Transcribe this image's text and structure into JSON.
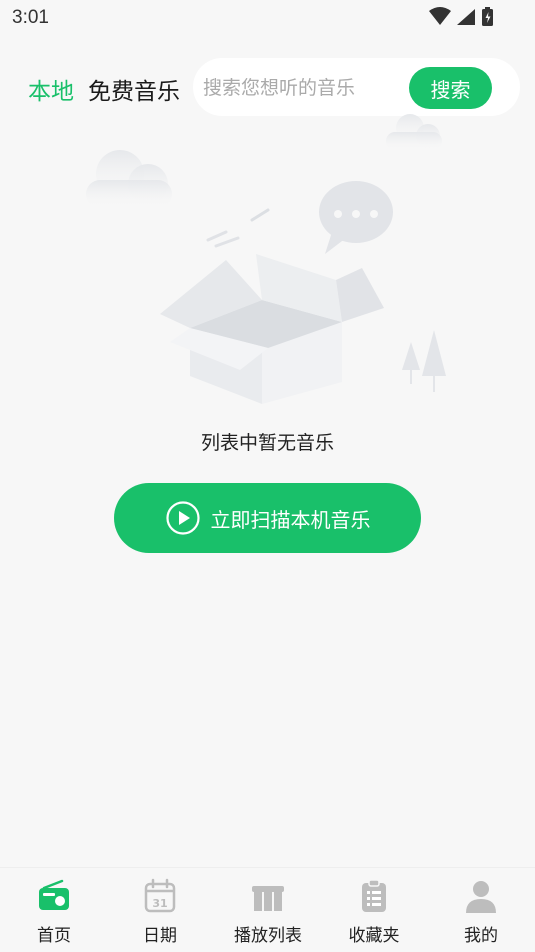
{
  "status": {
    "time": "3:01"
  },
  "header": {
    "tab_local": "本地",
    "tab_free": "免费音乐",
    "search_placeholder": "搜索您想听的音乐",
    "search_button": "搜索"
  },
  "empty": {
    "message": "列表中暂无音乐",
    "scan_button": "立即扫描本机音乐"
  },
  "nav": {
    "items": [
      {
        "label": "首页",
        "icon": "radio-icon",
        "active": true
      },
      {
        "label": "日期",
        "icon": "calendar-icon",
        "calendar_day": "31"
      },
      {
        "label": "播放列表",
        "icon": "playlist-icon"
      },
      {
        "label": "收藏夹",
        "icon": "clipboard-icon"
      },
      {
        "label": "我的",
        "icon": "user-icon"
      }
    ]
  },
  "colors": {
    "accent": "#19c06a",
    "icon_gray": "#bdbdbd",
    "background": "#f7f7f7"
  }
}
